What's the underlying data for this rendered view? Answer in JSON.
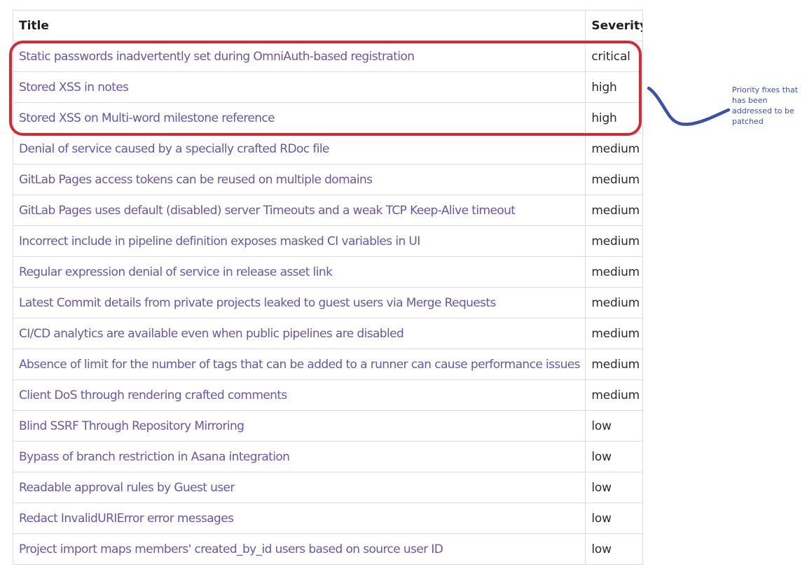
{
  "table": {
    "headers": {
      "title": "Title",
      "severity": "Severity"
    },
    "rows": [
      {
        "title": "Static passwords inadvertently set during OmniAuth-based registration",
        "severity": "critical"
      },
      {
        "title": "Stored XSS in notes",
        "severity": "high"
      },
      {
        "title": "Stored XSS on Multi-word milestone reference",
        "severity": "high"
      },
      {
        "title": "Denial of service caused by a specially crafted RDoc file",
        "severity": "medium"
      },
      {
        "title": "GitLab Pages access tokens can be reused on multiple domains",
        "severity": "medium"
      },
      {
        "title": "GitLab Pages uses default (disabled) server Timeouts and a weak TCP Keep-Alive timeout",
        "severity": "medium"
      },
      {
        "title": "Incorrect include in pipeline definition exposes masked CI variables in UI",
        "severity": "medium"
      },
      {
        "title": "Regular expression denial of service in release asset link",
        "severity": "medium"
      },
      {
        "title": "Latest Commit details from private projects leaked to guest users via Merge Requests",
        "severity": "medium"
      },
      {
        "title": "CI/CD analytics are available even when public pipelines are disabled",
        "severity": "medium"
      },
      {
        "title": "Absence of limit for the number of tags that can be added to a runner can cause performance issues",
        "severity": "medium"
      },
      {
        "title": "Client DoS through rendering crafted comments",
        "severity": "medium"
      },
      {
        "title": "Blind SSRF Through Repository Mirroring",
        "severity": "low"
      },
      {
        "title": "Bypass of branch restriction in Asana integration",
        "severity": "low"
      },
      {
        "title": "Readable approval rules by Guest user",
        "severity": "low"
      },
      {
        "title": "Redact InvalidURIError error messages",
        "severity": "low"
      },
      {
        "title": "Project import maps members' created_by_id users based on source user ID",
        "severity": "low"
      }
    ]
  },
  "annotation": {
    "text": "Priority fixes that has been addressed to be patched",
    "highlight_color": "#d42a35",
    "pen_color": "#3a4fb0"
  },
  "colors": {
    "link": "#6a55a8",
    "border": "#dcdcdc"
  }
}
